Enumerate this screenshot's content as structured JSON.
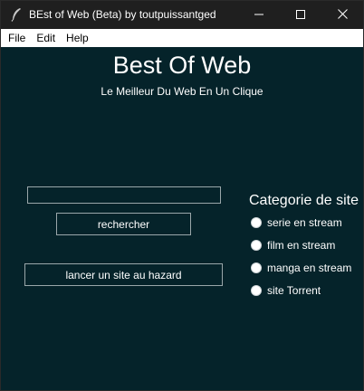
{
  "window": {
    "title": "BEst of Web (Beta) by toutpuissantged",
    "app_icon": "feather-icon",
    "controls": [
      "minimize-icon",
      "maximize-icon",
      "close-icon"
    ]
  },
  "menu": {
    "file": "File",
    "edit": "Edit",
    "help": "Help"
  },
  "main": {
    "title": "Best Of Web",
    "subtitle": "Le Meilleur Du Web En Un Clique",
    "search": {
      "value": "",
      "placeholder": ""
    },
    "search_button": "rechercher",
    "random_button": "lancer un site au hazard"
  },
  "category": {
    "title": "Categorie de site",
    "options": [
      {
        "label": "serie en stream",
        "selected": false
      },
      {
        "label": "film en stream",
        "selected": false
      },
      {
        "label": "manga en stream",
        "selected": false
      },
      {
        "label": "site Torrent",
        "selected": false
      }
    ]
  },
  "colors": {
    "background": "#05232a",
    "titlebar": "#1f1f1f",
    "text": "#ffffff",
    "border": "#9aa7aa"
  }
}
